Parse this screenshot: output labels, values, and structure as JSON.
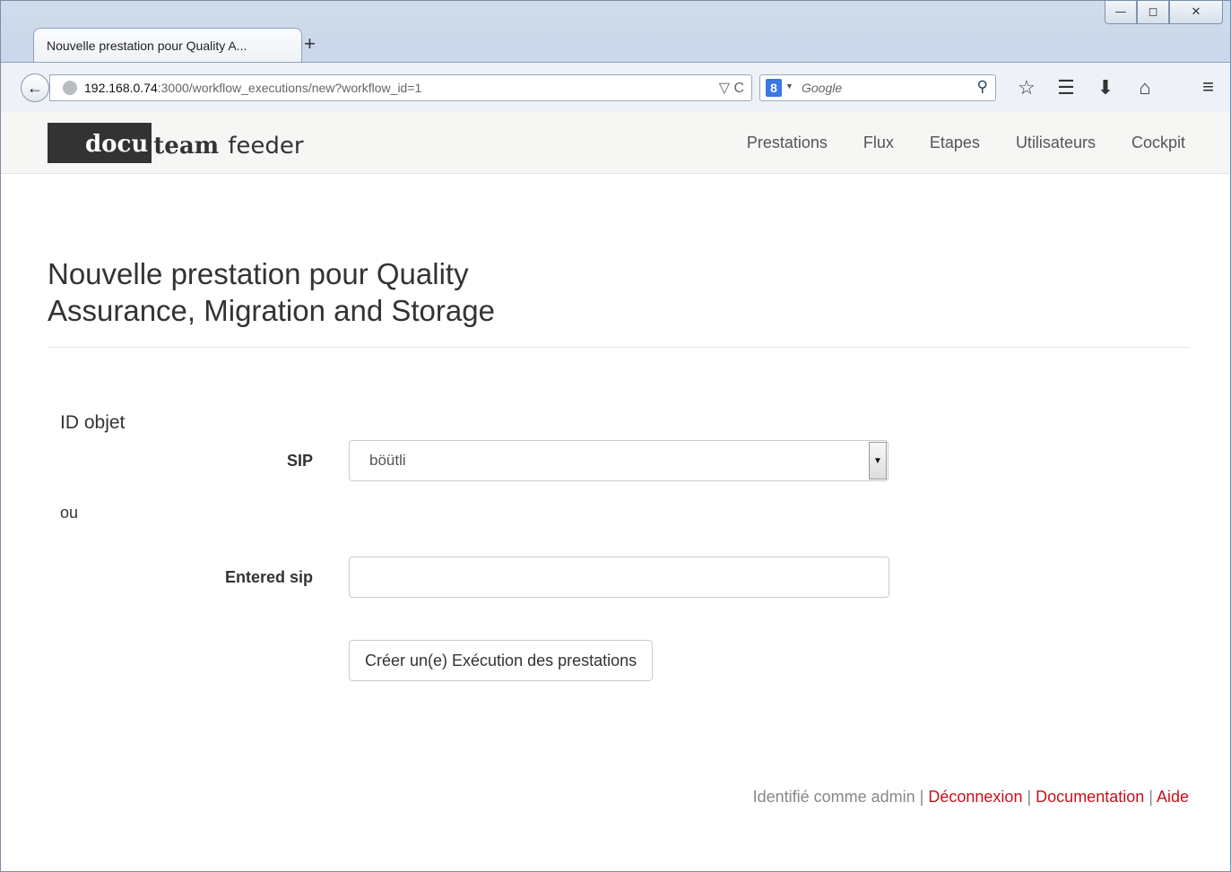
{
  "browser": {
    "tab_title": "Nouvelle prestation pour Quality A...",
    "new_tab_symbol": "+",
    "url_host": "192.168.0.74",
    "url_rest": ":3000/workflow_executions/new?workflow_id=1",
    "url_tools": "▽ C",
    "search_engine_badge": "8",
    "search_placeholder": "Google",
    "window_buttons": {
      "minimize": "—",
      "maximize": "◻",
      "close": "✕"
    }
  },
  "app": {
    "logo": {
      "docu": "docu",
      "team": "team",
      "feeder": "feeder"
    },
    "menu": [
      "Prestations",
      "Flux",
      "Etapes",
      "Utilisateurs",
      "Cockpit"
    ]
  },
  "form": {
    "title": "Nouvelle prestation pour Quality Assurance, Migration and Storage",
    "legend": "ID objet",
    "sip_label": "SIP",
    "sip_selected": "böütli",
    "or_text": "ou",
    "entered_sip_label": "Entered sip",
    "entered_sip_value": "",
    "submit_label": "Créer un(e) Exécution des prestations"
  },
  "footer": {
    "identified_as": "Identifié comme admin",
    "sep": "|",
    "logout": "Déconnexion",
    "documentation": "Documentation",
    "help": "Aide"
  }
}
